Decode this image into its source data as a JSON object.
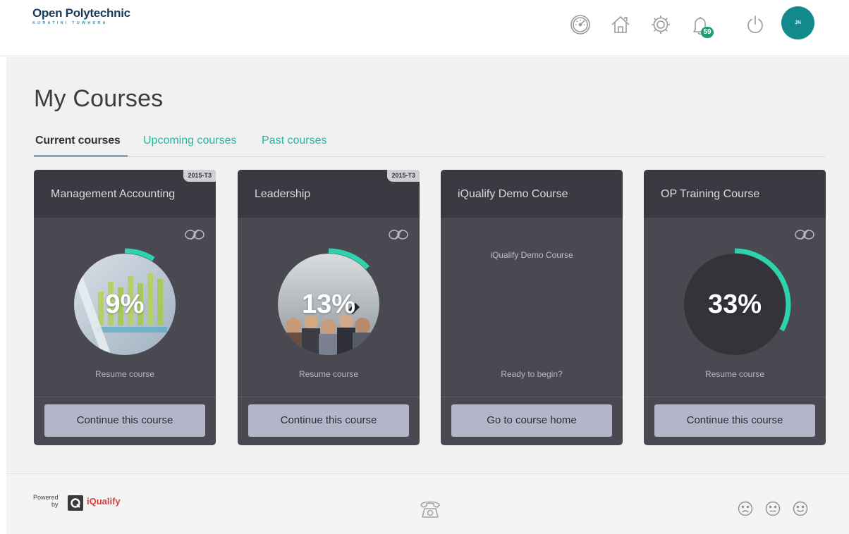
{
  "brand": {
    "name": "Open Polytechnic",
    "tagline": "KURATINI TUWHERA"
  },
  "header": {
    "notification_count": "59",
    "avatar_initials": "JN",
    "icons": [
      "dashboard-icon",
      "home-icon",
      "settings-icon",
      "notifications-icon",
      "power-icon"
    ]
  },
  "page": {
    "title": "My Courses"
  },
  "tabs": [
    {
      "label": "Current courses",
      "active": true
    },
    {
      "label": "Upcoming courses",
      "active": false
    },
    {
      "label": "Past courses",
      "active": false
    }
  ],
  "colors": {
    "accent": "#23b8a0",
    "card_body": "#4a4952",
    "card_header": "#3b3a42",
    "button": "#b3b5c8",
    "avatar": "#128a8c",
    "badge": "#1e9e74"
  },
  "cards": [
    {
      "title": "Management Accounting",
      "term": "2015-T3",
      "progress_label": "9%",
      "progress": 0.09,
      "image": "accounting-chart-photo",
      "caption": "Resume course",
      "button": "Continue this course"
    },
    {
      "title": "Leadership",
      "term": "2015-T3",
      "progress_label": "13%",
      "progress": 0.13,
      "image": "team-meeting-photo",
      "caption": "Resume course",
      "button": "Continue this course"
    },
    {
      "title": "iQualify Demo Course",
      "subtitle": "iQualify Demo Course",
      "caption": "Ready to begin?",
      "button": "Go to course home"
    },
    {
      "title": "OP Training Course",
      "progress_label": "33%",
      "progress": 0.33,
      "caption": "Resume course",
      "button": "Continue this course"
    }
  ],
  "footer": {
    "powered_line1": "Powered",
    "powered_line2": "by",
    "provider": "iQualify",
    "icons": [
      "phone-icon",
      "sad-face-icon",
      "neutral-face-icon",
      "happy-face-icon"
    ]
  }
}
